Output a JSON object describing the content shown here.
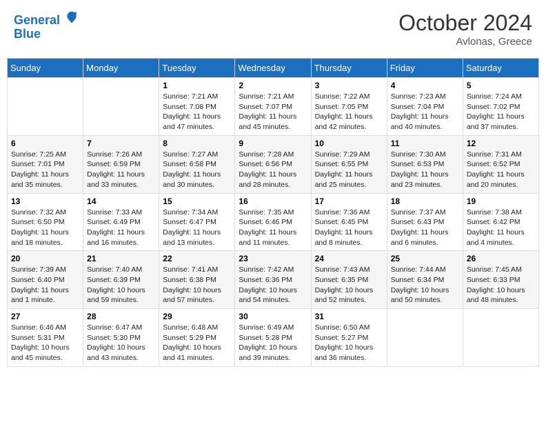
{
  "header": {
    "logo_line1": "General",
    "logo_line2": "Blue",
    "month": "October 2024",
    "location": "Avlonas, Greece"
  },
  "weekdays": [
    "Sunday",
    "Monday",
    "Tuesday",
    "Wednesday",
    "Thursday",
    "Friday",
    "Saturday"
  ],
  "weeks": [
    [
      {
        "day": "",
        "info": ""
      },
      {
        "day": "",
        "info": ""
      },
      {
        "day": "1",
        "info": "Sunrise: 7:21 AM\nSunset: 7:08 PM\nDaylight: 11 hours and 47 minutes."
      },
      {
        "day": "2",
        "info": "Sunrise: 7:21 AM\nSunset: 7:07 PM\nDaylight: 11 hours and 45 minutes."
      },
      {
        "day": "3",
        "info": "Sunrise: 7:22 AM\nSunset: 7:05 PM\nDaylight: 11 hours and 42 minutes."
      },
      {
        "day": "4",
        "info": "Sunrise: 7:23 AM\nSunset: 7:04 PM\nDaylight: 11 hours and 40 minutes."
      },
      {
        "day": "5",
        "info": "Sunrise: 7:24 AM\nSunset: 7:02 PM\nDaylight: 11 hours and 37 minutes."
      }
    ],
    [
      {
        "day": "6",
        "info": "Sunrise: 7:25 AM\nSunset: 7:01 PM\nDaylight: 11 hours and 35 minutes."
      },
      {
        "day": "7",
        "info": "Sunrise: 7:26 AM\nSunset: 6:59 PM\nDaylight: 11 hours and 33 minutes."
      },
      {
        "day": "8",
        "info": "Sunrise: 7:27 AM\nSunset: 6:58 PM\nDaylight: 11 hours and 30 minutes."
      },
      {
        "day": "9",
        "info": "Sunrise: 7:28 AM\nSunset: 6:56 PM\nDaylight: 11 hours and 28 minutes."
      },
      {
        "day": "10",
        "info": "Sunrise: 7:29 AM\nSunset: 6:55 PM\nDaylight: 11 hours and 25 minutes."
      },
      {
        "day": "11",
        "info": "Sunrise: 7:30 AM\nSunset: 6:53 PM\nDaylight: 11 hours and 23 minutes."
      },
      {
        "day": "12",
        "info": "Sunrise: 7:31 AM\nSunset: 6:52 PM\nDaylight: 11 hours and 20 minutes."
      }
    ],
    [
      {
        "day": "13",
        "info": "Sunrise: 7:32 AM\nSunset: 6:50 PM\nDaylight: 11 hours and 18 minutes."
      },
      {
        "day": "14",
        "info": "Sunrise: 7:33 AM\nSunset: 6:49 PM\nDaylight: 11 hours and 16 minutes."
      },
      {
        "day": "15",
        "info": "Sunrise: 7:34 AM\nSunset: 6:47 PM\nDaylight: 11 hours and 13 minutes."
      },
      {
        "day": "16",
        "info": "Sunrise: 7:35 AM\nSunset: 6:46 PM\nDaylight: 11 hours and 11 minutes."
      },
      {
        "day": "17",
        "info": "Sunrise: 7:36 AM\nSunset: 6:45 PM\nDaylight: 11 hours and 8 minutes."
      },
      {
        "day": "18",
        "info": "Sunrise: 7:37 AM\nSunset: 6:43 PM\nDaylight: 11 hours and 6 minutes."
      },
      {
        "day": "19",
        "info": "Sunrise: 7:38 AM\nSunset: 6:42 PM\nDaylight: 11 hours and 4 minutes."
      }
    ],
    [
      {
        "day": "20",
        "info": "Sunrise: 7:39 AM\nSunset: 6:40 PM\nDaylight: 11 hours and 1 minute."
      },
      {
        "day": "21",
        "info": "Sunrise: 7:40 AM\nSunset: 6:39 PM\nDaylight: 10 hours and 59 minutes."
      },
      {
        "day": "22",
        "info": "Sunrise: 7:41 AM\nSunset: 6:38 PM\nDaylight: 10 hours and 57 minutes."
      },
      {
        "day": "23",
        "info": "Sunrise: 7:42 AM\nSunset: 6:36 PM\nDaylight: 10 hours and 54 minutes."
      },
      {
        "day": "24",
        "info": "Sunrise: 7:43 AM\nSunset: 6:35 PM\nDaylight: 10 hours and 52 minutes."
      },
      {
        "day": "25",
        "info": "Sunrise: 7:44 AM\nSunset: 6:34 PM\nDaylight: 10 hours and 50 minutes."
      },
      {
        "day": "26",
        "info": "Sunrise: 7:45 AM\nSunset: 6:33 PM\nDaylight: 10 hours and 48 minutes."
      }
    ],
    [
      {
        "day": "27",
        "info": "Sunrise: 6:46 AM\nSunset: 5:31 PM\nDaylight: 10 hours and 45 minutes."
      },
      {
        "day": "28",
        "info": "Sunrise: 6:47 AM\nSunset: 5:30 PM\nDaylight: 10 hours and 43 minutes."
      },
      {
        "day": "29",
        "info": "Sunrise: 6:48 AM\nSunset: 5:29 PM\nDaylight: 10 hours and 41 minutes."
      },
      {
        "day": "30",
        "info": "Sunrise: 6:49 AM\nSunset: 5:28 PM\nDaylight: 10 hours and 39 minutes."
      },
      {
        "day": "31",
        "info": "Sunrise: 6:50 AM\nSunset: 5:27 PM\nDaylight: 10 hours and 36 minutes."
      },
      {
        "day": "",
        "info": ""
      },
      {
        "day": "",
        "info": ""
      }
    ]
  ]
}
